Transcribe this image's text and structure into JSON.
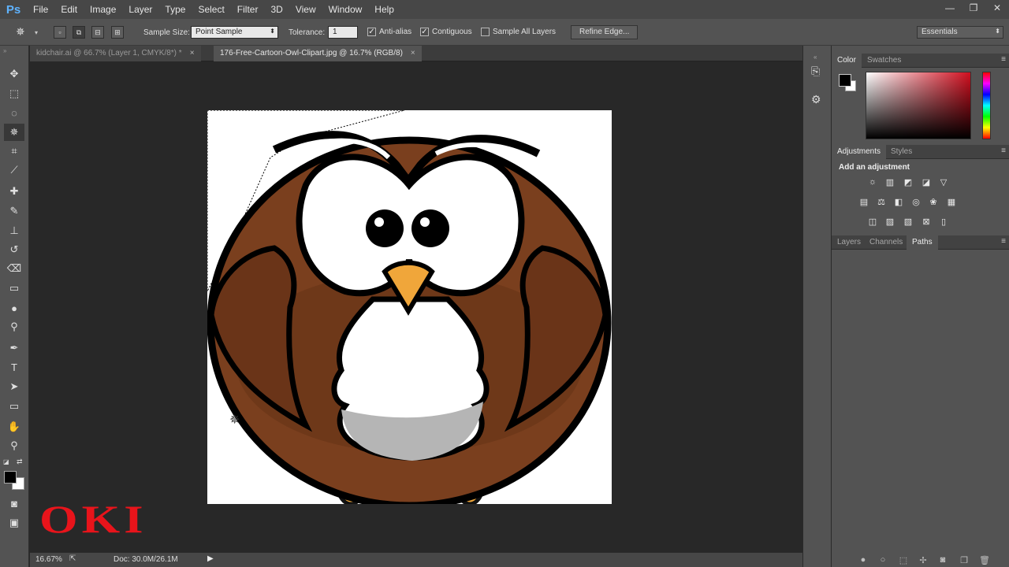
{
  "app": {
    "logo": "Ps"
  },
  "menu": [
    "File",
    "Edit",
    "Image",
    "Layer",
    "Type",
    "Select",
    "Filter",
    "3D",
    "View",
    "Window",
    "Help"
  ],
  "window_controls": {
    "minimize": "—",
    "restore": "❐",
    "close": "✕"
  },
  "options": {
    "sample_size_label": "Sample Size:",
    "sample_size_value": "Point Sample",
    "tolerance_label": "Tolerance:",
    "tolerance_value": "1",
    "anti_alias_label": "Anti-alias",
    "anti_alias_checked": true,
    "contiguous_label": "Contiguous",
    "contiguous_checked": true,
    "sample_all_layers_label": "Sample All Layers",
    "sample_all_layers_checked": false,
    "refine_edge_label": "Refine Edge...",
    "workspace_value": "Essentials"
  },
  "tabs": [
    {
      "label": "kidchair.ai @ 66.7% (Layer 1, CMYK/8*) *",
      "active": false
    },
    {
      "label": "176-Free-Cartoon-Owl-Clipart.jpg @ 16.7% (RGB/8)",
      "active": true
    }
  ],
  "tab_close": "×",
  "status": {
    "zoom": "16.67%",
    "doc": "Doc: 30.0M/26.1M"
  },
  "watermark": {
    "text": "OKI",
    "color": "#e8141b"
  },
  "panels": {
    "color_tabs": [
      "Color",
      "Swatches"
    ],
    "adjust_tabs": [
      "Adjustments",
      "Styles"
    ],
    "add_adjustment": "Add an adjustment",
    "layers_tabs": [
      "Layers",
      "Channels",
      "Paths"
    ]
  },
  "colors": {
    "foreground": "#000000",
    "background": "#ffffff",
    "picker_hue": "#d10f1f"
  }
}
